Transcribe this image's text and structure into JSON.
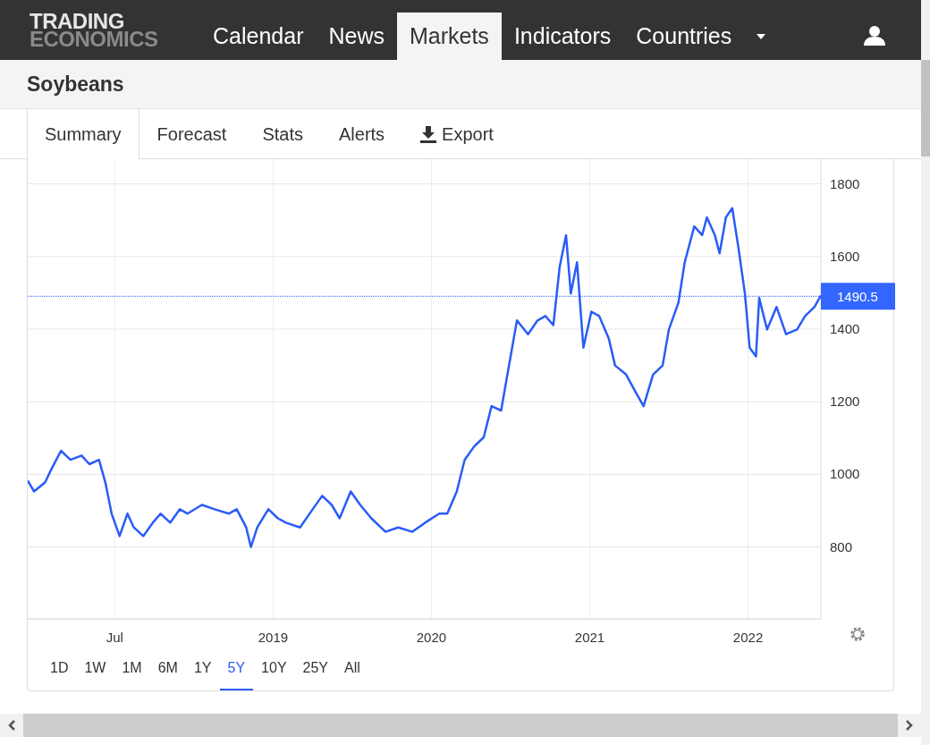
{
  "logo": {
    "line_1": "TRADING",
    "line_2": "ECONOMICS"
  },
  "nav": {
    "items": [
      {
        "label": "Calendar",
        "selected": false
      },
      {
        "label": "News",
        "selected": false
      },
      {
        "label": "Markets",
        "selected": true
      },
      {
        "label": "Indicators",
        "selected": false
      },
      {
        "label": "Countries",
        "selected": false
      }
    ]
  },
  "page_title": "Soybeans",
  "tabs": [
    {
      "label": "Summary",
      "kind": "tab",
      "selected": true
    },
    {
      "label": "Forecast",
      "kind": "tab",
      "selected": false
    },
    {
      "label": "Stats",
      "kind": "tab",
      "selected": false
    },
    {
      "label": "Alerts",
      "kind": "tab",
      "selected": false
    },
    {
      "label": "Export",
      "kind": "action",
      "selected": false
    }
  ],
  "chart": {
    "chart_data": {
      "type": "line",
      "xlim": [
        2017.45,
        2022.46
      ],
      "ylim": [
        602,
        1868
      ],
      "xticks": [
        {
          "value": 2018.0,
          "label": "Jul"
        },
        2019,
        2020,
        2021,
        2022
      ],
      "yticks": [
        800,
        1000,
        1200,
        1400,
        1600,
        1800
      ],
      "grid": true,
      "ref_lines": [
        {
          "axis": "y",
          "value": 1490.5,
          "label": "1490.5"
        }
      ],
      "x": [
        2017.45,
        2017.49,
        2017.56,
        2017.6,
        2017.66,
        2017.72,
        2017.79,
        2017.84,
        2017.9,
        2017.94,
        2017.98,
        2018.03,
        2018.08,
        2018.12,
        2018.18,
        2018.24,
        2018.29,
        2018.35,
        2018.41,
        2018.46,
        2018.55,
        2018.63,
        2018.72,
        2018.77,
        2018.83,
        2018.86,
        2018.9,
        2018.97,
        2019.03,
        2019.08,
        2019.17,
        2019.25,
        2019.31,
        2019.37,
        2019.42,
        2019.49,
        2019.55,
        2019.62,
        2019.71,
        2019.79,
        2019.88,
        2019.96,
        2020.05,
        2020.1,
        2020.16,
        2020.21,
        2020.27,
        2020.33,
        2020.38,
        2020.44,
        2020.5,
        2020.54,
        2020.61,
        2020.67,
        2020.72,
        2020.77,
        2020.81,
        2020.85,
        2020.88,
        2020.92,
        2020.96,
        2021.01,
        2021.06,
        2021.12,
        2021.16,
        2021.23,
        2021.29,
        2021.34,
        2021.4,
        2021.46,
        2021.5,
        2021.56,
        2021.6,
        2021.66,
        2021.71,
        2021.74,
        2021.79,
        2021.82,
        2021.86,
        2021.9,
        2021.94,
        2021.98,
        2022.01,
        2022.05,
        2022.07,
        2022.12,
        2022.18,
        2022.24,
        2022.31,
        2022.36,
        2022.42,
        2022.46
      ],
      "series": [
        {
          "color": "#2a5cf6",
          "values": [
            983,
            953,
            978,
            1015,
            1065,
            1040,
            1052,
            1028,
            1040,
            978,
            892,
            830,
            892,
            854,
            830,
            867,
            892,
            867,
            904,
            892,
            916,
            904,
            892,
            904,
            854,
            800,
            854,
            904,
            879,
            867,
            854,
            904,
            941,
            916,
            879,
            953,
            916,
            879,
            842,
            854,
            842,
            867,
            892,
            892,
            953,
            1040,
            1077,
            1102,
            1188,
            1176,
            1325,
            1424,
            1386,
            1424,
            1436,
            1411,
            1572,
            1659,
            1498,
            1584,
            1349,
            1448,
            1436,
            1374,
            1300,
            1275,
            1226,
            1188,
            1275,
            1300,
            1399,
            1473,
            1584,
            1683,
            1659,
            1708,
            1659,
            1609,
            1708,
            1733,
            1622,
            1498,
            1349,
            1325,
            1486,
            1399,
            1461,
            1386,
            1399,
            1436,
            1461,
            1493
          ]
        }
      ]
    }
  },
  "ranges": [
    {
      "label": "1D",
      "selected": false
    },
    {
      "label": "1W",
      "selected": false
    },
    {
      "label": "1M",
      "selected": false
    },
    {
      "label": "6M",
      "selected": false
    },
    {
      "label": "1Y",
      "selected": false
    },
    {
      "label": "5Y",
      "selected": true
    },
    {
      "label": "10Y",
      "selected": false
    },
    {
      "label": "25Y",
      "selected": false
    },
    {
      "label": "All",
      "selected": false
    }
  ]
}
